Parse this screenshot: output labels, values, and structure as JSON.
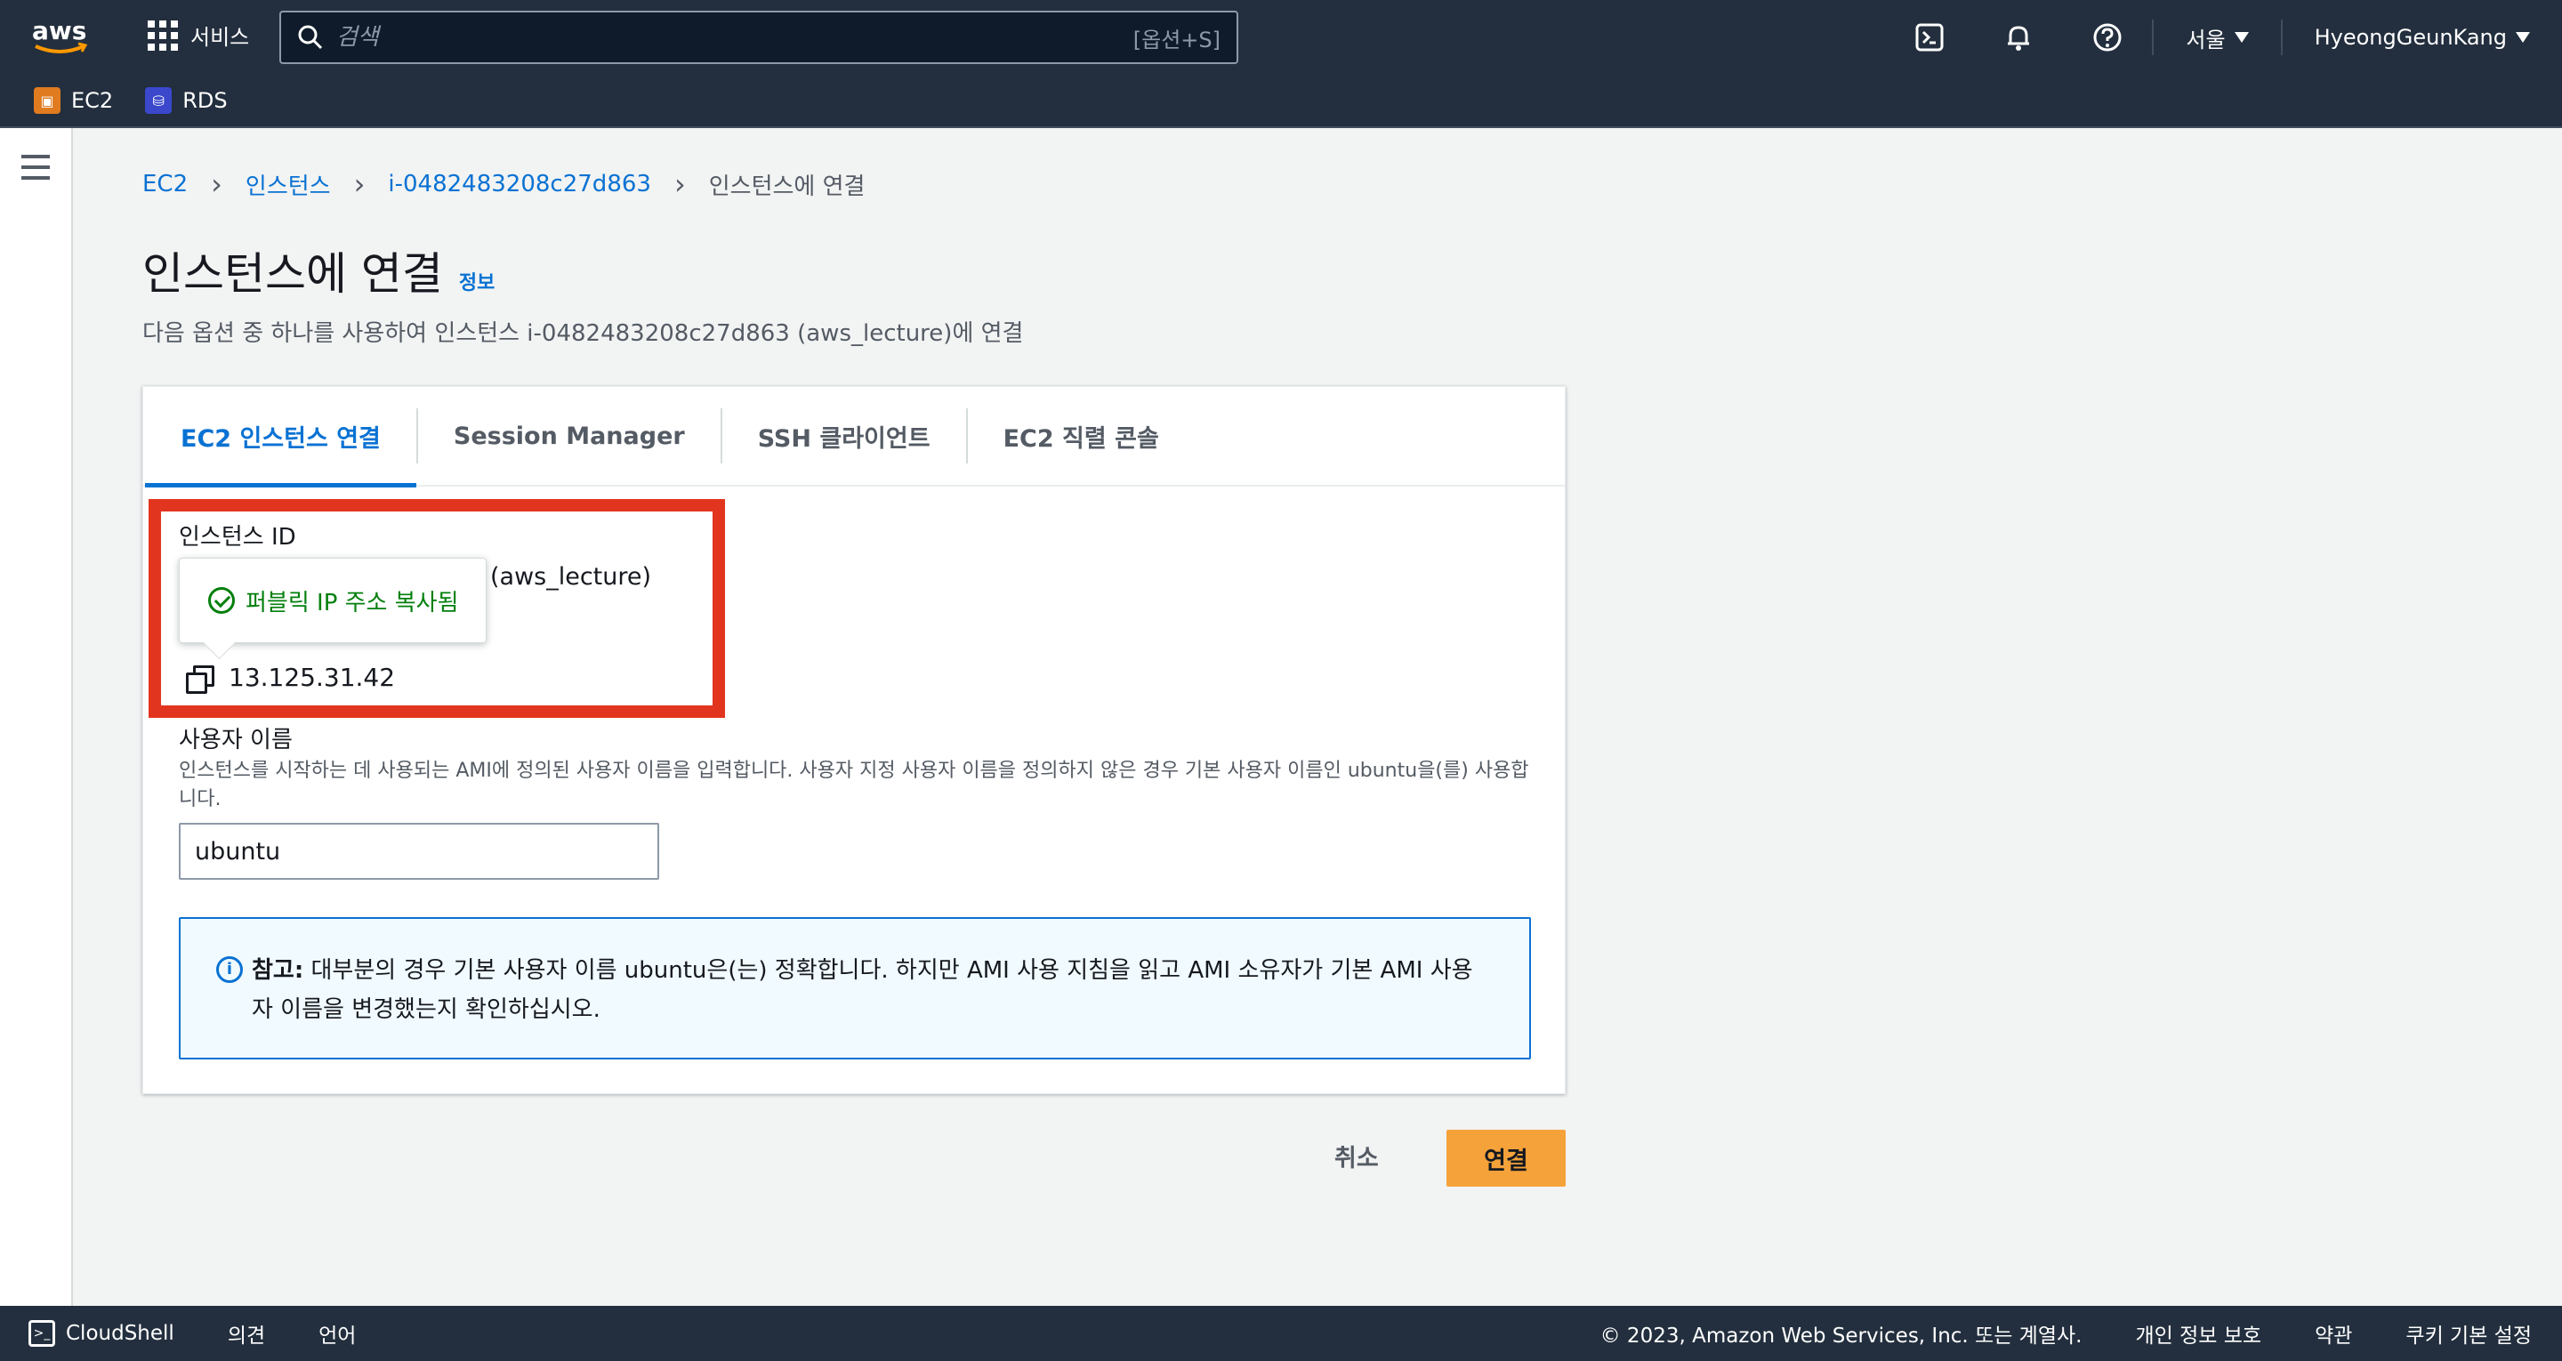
{
  "nav": {
    "logo": "aws",
    "services_label": "서비스",
    "search_placeholder": "검색",
    "search_shortcut": "[옵션+S]",
    "region": "서울",
    "user": "HyeongGeunKang"
  },
  "favorites": [
    {
      "label": "EC2",
      "color": "#e07b1f"
    },
    {
      "label": "RDS",
      "color": "#3b48cc"
    }
  ],
  "breadcrumb": {
    "items": [
      "EC2",
      "인스턴스",
      "i-0482483208c27d863"
    ],
    "current": "인스턴스에 연결"
  },
  "page": {
    "title": "인스턴스에 연결",
    "info": "정보",
    "description": "다음 옵션 중 하나를 사용하여 인스턴스 i-0482483208c27d863 (aws_lecture)에 연결"
  },
  "tabs": [
    "EC2 인스턴스 연결",
    "Session Manager",
    "SSH 클라이언트",
    "EC2 직렬 콘솔"
  ],
  "form": {
    "instance_id_label": "인스턴스 ID",
    "instance_id_value_suffix": "(aws_lecture)",
    "popover": "퍼블릭 IP 주소 복사됨",
    "public_ip": "13.125.31.42",
    "username_label": "사용자 이름",
    "username_help": "인스턴스를 시작하는 데 사용되는 AMI에 정의된 사용자 이름을 입력합니다. 사용자 지정 사용자 이름을 정의하지 않은 경우 기본 사용자 이름인 ubuntu을(를) 사용합니다.",
    "username_value": "ubuntu"
  },
  "alert": {
    "title": "참고:",
    "text": " 대부분의 경우 기본 사용자 이름 ubuntu은(는) 정확합니다. 하지만 AMI 사용 지침을 읽고 AMI 소유자가 기본 AMI 사용자 이름을 변경했는지 확인하십시오."
  },
  "actions": {
    "cancel": "취소",
    "connect": "연결"
  },
  "footer": {
    "cloudshell": "CloudShell",
    "feedback": "의견",
    "language": "언어",
    "copyright": "© 2023, Amazon Web Services, Inc. 또는 계열사.",
    "privacy": "개인 정보 보호",
    "terms": "약관",
    "cookies": "쿠키 기본 설정"
  },
  "colors": {
    "highlight": "#e2351f",
    "link": "#0972d3",
    "primary": "#f5a23a"
  }
}
